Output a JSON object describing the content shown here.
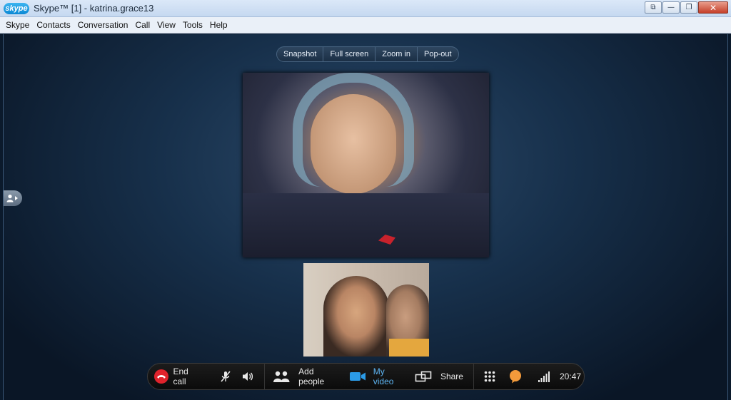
{
  "window": {
    "logo_text": "skype",
    "title": "Skype™ [1] - katrina.grace13",
    "controls": {
      "restore_down": "⧉",
      "minimize": "—",
      "maximize": "❐",
      "close": "✕"
    }
  },
  "menu": [
    "Skype",
    "Contacts",
    "Conversation",
    "Call",
    "View",
    "Tools",
    "Help"
  ],
  "video_toolbar": {
    "snapshot": "Snapshot",
    "full_screen": "Full screen",
    "zoom_in": "Zoom in",
    "pop_out": "Pop-out"
  },
  "call_bar": {
    "end_call": "End call",
    "add_people": "Add people",
    "my_video": "My video",
    "share": "Share",
    "time": "20:47"
  },
  "colors": {
    "end_call_red": "#e0232c",
    "my_video_blue": "#2b9be8",
    "chat_orange": "#f39a3b"
  },
  "icons": {
    "end_call": "phone-hangup-icon",
    "mute": "microphone-muted-icon",
    "volume": "speaker-icon",
    "add_people": "add-people-icon",
    "my_video": "video-camera-icon",
    "share": "share-screen-icon",
    "dialpad": "dialpad-icon",
    "chat": "chat-bubble-icon",
    "signal": "signal-strength-icon",
    "side_tab": "contact-panel-icon"
  }
}
